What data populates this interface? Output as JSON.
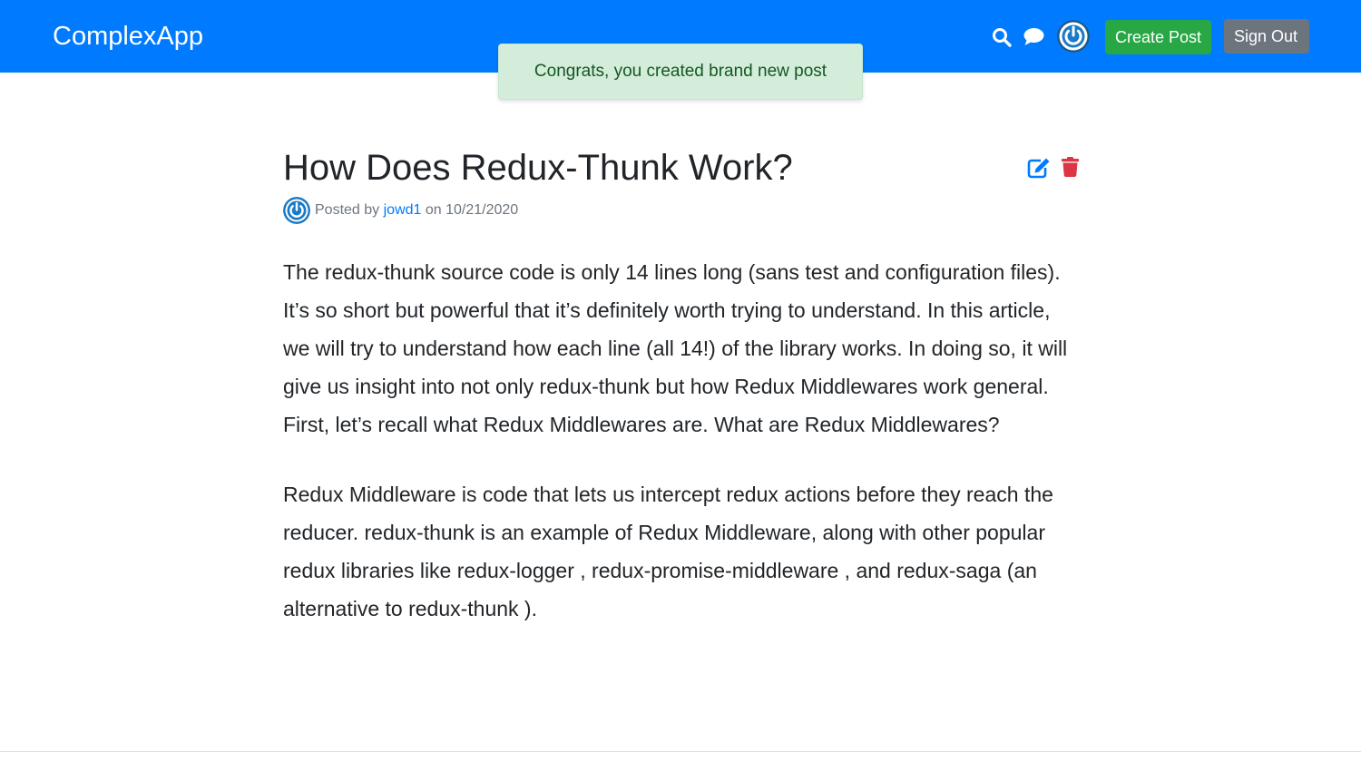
{
  "header": {
    "brand": "ComplexApp",
    "search_icon": "search-icon",
    "chat_icon": "chat-icon",
    "avatar_icon": "power-avatar",
    "create_post_label": "Create Post",
    "sign_out_label": "Sign Out",
    "background_color": "#007bff"
  },
  "flash": {
    "message": "Congrats, you created brand new post",
    "background_color": "#d4edda",
    "text_color": "#155724"
  },
  "post": {
    "title": "How Does Redux-Thunk Work?",
    "edit_icon": "edit-icon",
    "delete_icon": "trash-icon",
    "edit_color": "#007bff",
    "delete_color": "#dc3545",
    "meta": {
      "posted_by": "Posted by",
      "author": "jowd1",
      "on": "on",
      "date": "10/21/2020"
    },
    "paragraphs": [
      "The redux-thunk source code is only 14 lines long (sans test and configuration files). It’s so short but powerful that it’s definitely worth trying to understand. In this article, we will try to understand how each line (all 14!) of the library works. In doing so, it will give us insight into not only redux-thunk but how Redux Middlewares work general. First, let’s recall what Redux Middlewares are. What are Redux Middlewares?",
      "Redux Middleware is code that lets us intercept redux actions before they reach the reducer. redux-thunk is an example of Redux Middleware, along with other popular redux libraries like redux-logger , redux-promise-middleware , and redux-saga (an alternative to redux-thunk )."
    ]
  }
}
